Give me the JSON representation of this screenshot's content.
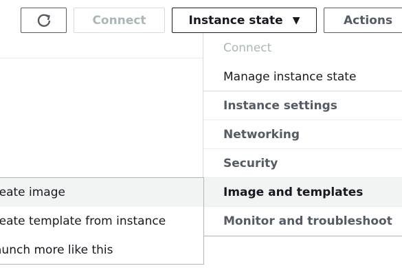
{
  "toolbar": {
    "refresh_icon": "refresh-icon",
    "connect_label": "Connect",
    "instance_state_label": "Instance state",
    "instance_state_caret": "▼",
    "actions_label": "Actions",
    "actions_caret": "▼"
  },
  "actions_menu": {
    "items": [
      {
        "label": "Connect",
        "state": "disabled"
      },
      {
        "label": "Manage instance state",
        "state": "enabled"
      },
      {
        "label": "Instance settings",
        "state": "group"
      },
      {
        "label": "Networking",
        "state": "group"
      },
      {
        "label": "Security",
        "state": "group"
      },
      {
        "label": "Image and templates",
        "state": "group-expanded"
      },
      {
        "label": "Monitor and troubleshoot",
        "state": "group"
      }
    ]
  },
  "submenu": {
    "items": [
      {
        "label": "reate image"
      },
      {
        "label": "reate template from instance"
      },
      {
        "label": "aunch more like this"
      }
    ]
  },
  "colors": {
    "text": "#16191f",
    "muted": "#545b64",
    "disabled": "#aab7b8",
    "hover_bg": "#f2f3f3"
  }
}
